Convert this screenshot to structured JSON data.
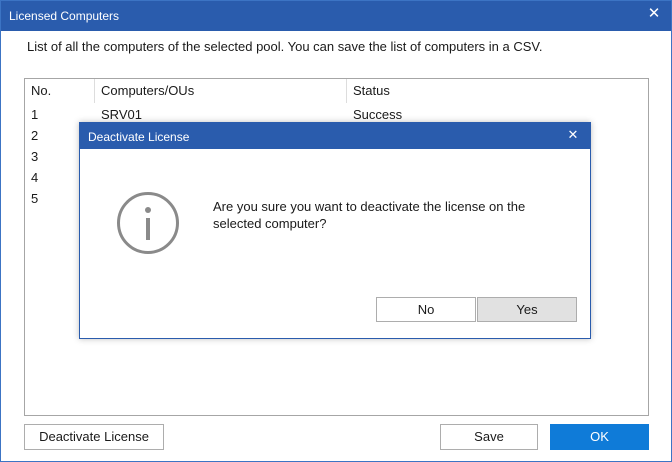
{
  "window": {
    "title": "Licensed Computers",
    "close_glyph": "✕",
    "description": "List of all the computers of the selected pool. You can save the list of computers in a CSV."
  },
  "list": {
    "columns": [
      "No.",
      "Computers/OUs",
      "Status"
    ],
    "rows": [
      {
        "no": "1",
        "computer": "SRV01",
        "status": "Success"
      },
      {
        "no": "2",
        "computer": "",
        "status": ""
      },
      {
        "no": "3",
        "computer": "",
        "status": ""
      },
      {
        "no": "4",
        "computer": "",
        "status": ""
      },
      {
        "no": "5",
        "computer": "",
        "status": ""
      }
    ]
  },
  "buttons": {
    "deactivate": "Deactivate License",
    "save": "Save",
    "ok": "OK"
  },
  "dialog": {
    "title": "Deactivate License",
    "close_glyph": "✕",
    "icon": "info-icon",
    "message": "Are you sure you want to deactivate the license on the selected computer?",
    "no": "No",
    "yes": "Yes"
  },
  "colors": {
    "titlebar": "#2a5cad",
    "primary_button": "#0f7bd8"
  }
}
